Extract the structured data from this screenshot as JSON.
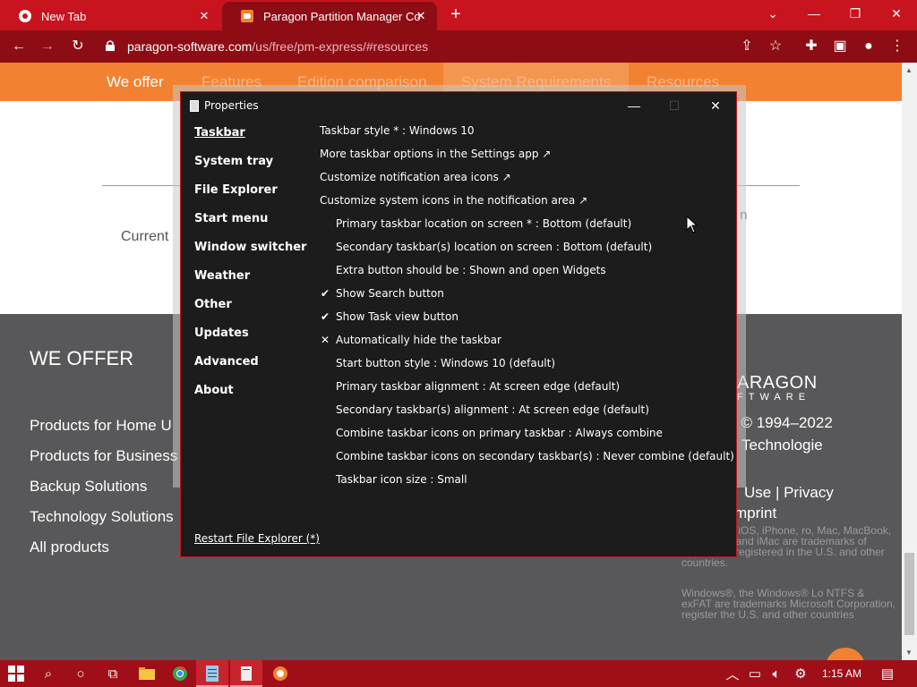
{
  "browser": {
    "tabs": [
      {
        "title": "New Tab"
      },
      {
        "title": "Paragon Partition Manager Comm"
      }
    ],
    "address": {
      "domain": "paragon-software.com",
      "path": "/us/free/pm-express/#resources"
    }
  },
  "website": {
    "nav": [
      "We offer",
      "Features",
      "Edition comparison",
      "System Requirements",
      "Resources"
    ],
    "current_text": "Current",
    "right_fragment": "n",
    "footer": {
      "heading": "WE OFFER",
      "links": [
        "Products for Home U",
        "Products for Business",
        "Backup Solutions",
        "Technology Solutions",
        "All products"
      ],
      "brand_line1": "ARAGON",
      "brand_line2": "FTWARE",
      "copyright": "t © 1994–2022",
      "company": "Technologie",
      "terms": "Use | Privacy",
      "imprint": "mprint",
      "legal1": "Apple logo, iOS, iPhone, ro, Mac, MacBook, ro, macOS and iMac are trademarks of Apple Inc., registered in the U.S. and other countries.",
      "legal2": "Windows®, the Windows® Lo NTFS & exFAT are trademarks Microsoft Corporation, register the U.S. and other countries"
    }
  },
  "dialog": {
    "title": "Properties",
    "sidebar": [
      "Taskbar",
      "System tray",
      "File Explorer",
      "Start menu",
      "Window switcher",
      "Weather",
      "Other",
      "Updates",
      "Advanced",
      "About"
    ],
    "active_section": "Taskbar",
    "options": [
      {
        "label": "Taskbar style * : Windows 10",
        "indent": false,
        "mark": ""
      },
      {
        "label": "More taskbar options in the Settings app ↗",
        "indent": false,
        "mark": ""
      },
      {
        "label": "Customize notification area icons ↗",
        "indent": false,
        "mark": ""
      },
      {
        "label": "Customize system icons in the notification area ↗",
        "indent": false,
        "mark": ""
      },
      {
        "label": "Primary taskbar location on screen * : Bottom (default)",
        "indent": true,
        "mark": ""
      },
      {
        "label": "Secondary taskbar(s) location on screen : Bottom (default)",
        "indent": true,
        "mark": ""
      },
      {
        "label": "Extra button should be : Shown and open Widgets",
        "indent": true,
        "mark": ""
      },
      {
        "label": "Show Search button",
        "indent": true,
        "mark": "✔"
      },
      {
        "label": "Show Task view button",
        "indent": true,
        "mark": "✔"
      },
      {
        "label": "Automatically hide the taskbar",
        "indent": true,
        "mark": "✕"
      },
      {
        "label": "Start button style : Windows 10 (default)",
        "indent": true,
        "mark": ""
      },
      {
        "label": "Primary taskbar alignment : At screen edge (default)",
        "indent": true,
        "mark": ""
      },
      {
        "label": "Secondary taskbar(s) alignment : At screen edge (default)",
        "indent": true,
        "mark": ""
      },
      {
        "label": "Combine taskbar icons on primary taskbar : Always combine",
        "indent": true,
        "mark": ""
      },
      {
        "label": "Combine taskbar icons on secondary taskbar(s) : Never combine (default)",
        "indent": true,
        "mark": ""
      },
      {
        "label": "Taskbar icon size : Small",
        "indent": true,
        "mark": ""
      }
    ],
    "restart_link": "Restart File Explorer (*)"
  },
  "taskbar": {
    "time": "1:15 AM",
    "icons": [
      "windows-start-icon",
      "search-icon",
      "cortana-icon",
      "task-view-icon",
      "file-explorer-icon",
      "chrome-icon",
      "notepad-icon",
      "explorer-patcher-icon",
      "paragon-icon"
    ]
  },
  "colors": {
    "accent": "#c8141e",
    "site_orange": "#f28232",
    "dialog_bg": "#1c1c1c"
  }
}
